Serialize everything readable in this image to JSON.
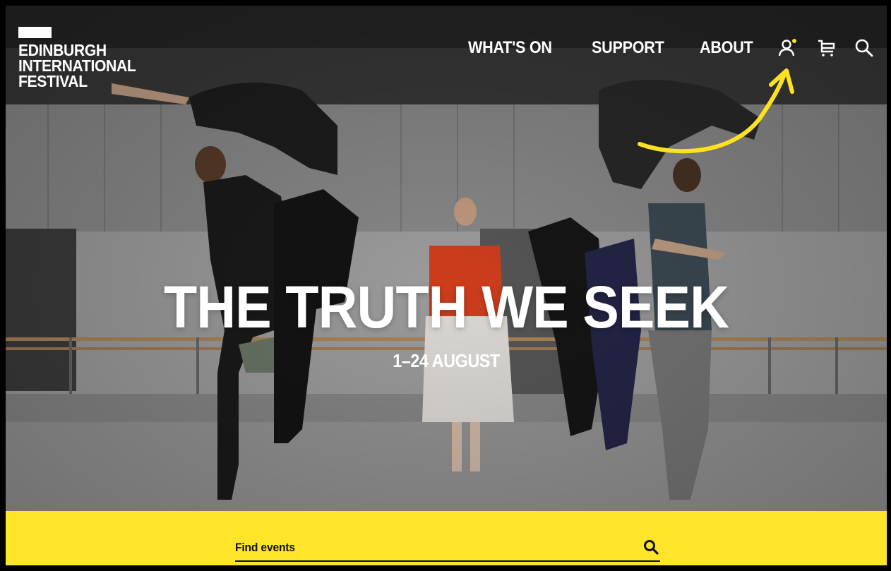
{
  "logo": {
    "lines": [
      "EDINBURGH",
      "INTERNATIONAL",
      "FESTIVAL"
    ]
  },
  "nav": {
    "items": [
      {
        "label": "WHAT'S ON"
      },
      {
        "label": "SUPPORT"
      },
      {
        "label": "ABOUT"
      }
    ],
    "icons": [
      "account-icon",
      "basket-icon",
      "search-icon"
    ]
  },
  "hero": {
    "title": "THE TRUTH WE SEEK",
    "dates": "1–24 AUGUST",
    "image": "dancers-rehearsal-photo"
  },
  "search": {
    "label": "Find events",
    "icon": "search-icon"
  },
  "colors": {
    "accent": "#ffe52a",
    "annotation": "#ffe21f",
    "text_light": "#ffffff",
    "text_dark": "#111111"
  }
}
